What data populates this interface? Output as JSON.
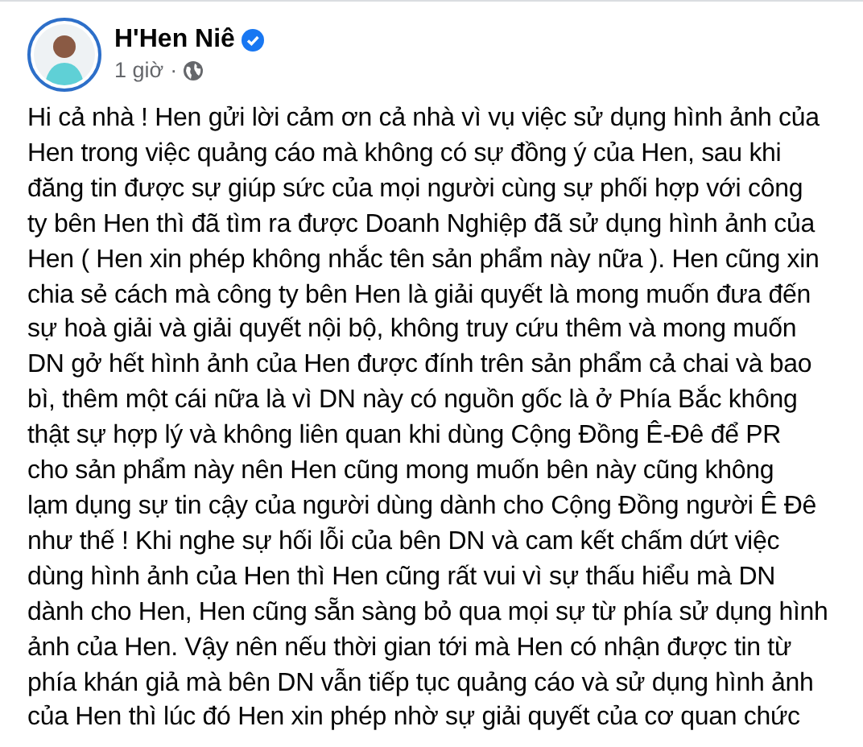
{
  "post": {
    "author": "H'Hen Niê",
    "verified": true,
    "time": "1 giờ",
    "separator": "·",
    "body_lines": [
      "Hi cả nhà ! Hen gửi lời cảm ơn cả nhà vì vụ việc sử dụng hình ảnh của",
      "Hen trong việc quảng cáo mà không có sự đồng ý của Hen, sau khi",
      "đăng tin được sự giúp sức của mọi người cùng sự phối hợp với công",
      "ty bên Hen thì đã tìm ra được Doanh Nghiệp đã sử dụng hình ảnh của",
      "Hen ( Hen xin phép không nhắc tên sản phẩm này nữa ). Hen cũng xin",
      "chia sẻ cách mà công ty bên Hen là giải quyết là mong muốn đưa đến",
      "sự hoà giải và giải quyết nội bộ, không truy cứu thêm và mong muốn",
      "DN gở hết hình ảnh của Hen được đính trên sản phẩm cả chai và bao",
      "bì, thêm một cái nữa là vì DN này có nguồn gốc là ở Phía Bắc không",
      "thật sự hợp lý và không liên quan khi dùng Cộng Đồng Ê-Đê để PR",
      "cho sản phẩm này nên Hen cũng mong muốn bên này cũng không",
      "lạm dụng sự tin cậy của người dùng dành cho Cộng Đồng người Ê Đê",
      "như thế ! Khi nghe sự hối lỗi của bên DN và cam kết chấm dứt việc",
      "dùng hình ảnh của Hen thì Hen cũng rất vui vì sự thấu hiểu mà DN",
      "dành cho Hen, Hen cũng sẵn sàng bỏ qua mọi sự từ phía sử dụng hình",
      "ảnh của Hen. Vậy nên nếu thời gian tới mà Hen có nhận được tin từ",
      "phía khán giả mà bên DN vẫn tiếp tục quảng cáo và sử dụng hình ảnh",
      "của Hen thì lúc đó Hen xin phép nhờ sự giải quyết của cơ quan chức"
    ]
  }
}
